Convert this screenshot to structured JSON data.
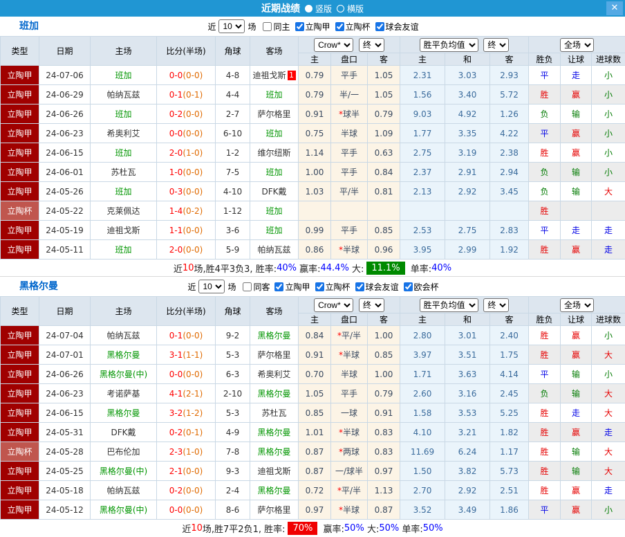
{
  "titlebar": {
    "title": "近期战绩",
    "vertical_label": "竖版",
    "horizontal_label": "横版",
    "close_glyph": "✕"
  },
  "colors": {
    "titlebar_blue": "#2096d3",
    "league_red": "#a00000",
    "cup_red": "#c0564e",
    "team_highlight_green": "#009500",
    "score_red": "#ff0000",
    "halftime_orange": "#e06a00",
    "win_red": "#e60000",
    "draw_blue": "#0000e6",
    "lose_green": "#007a00",
    "summary_badge_green": "#008a00",
    "summary_badge_red": "#f00000"
  },
  "sections": [
    {
      "team": "班加",
      "filter": {
        "near": "近",
        "count": "10",
        "games": "场",
        "same": {
          "label": "同主",
          "checked": false
        },
        "leagues": [
          {
            "label": "立陶甲",
            "checked": true
          },
          {
            "label": "立陶杯",
            "checked": true
          },
          {
            "label": "球会友谊",
            "checked": true
          }
        ]
      },
      "header": {
        "type": "类型",
        "date": "日期",
        "home": "主场",
        "score": "比分(半场)",
        "corner": "角球",
        "away": "客场",
        "company": "Crow*",
        "final1": "终",
        "avg_label": "胜平负均值",
        "final2": "终",
        "scope": "全场",
        "odds_cols": [
          "主",
          "盘口",
          "客"
        ],
        "avg_cols": [
          "主",
          "和",
          "客"
        ],
        "full_cols": [
          "胜负",
          "让球",
          "进球数"
        ]
      },
      "rows": [
        {
          "league": "立陶甲",
          "cup": false,
          "date": "24-07-06",
          "home": "班加",
          "hh": true,
          "score": "0-0",
          "half": "(0-0)",
          "corner": "4-8",
          "away": "迪祖戈斯",
          "ah": false,
          "badge": "1",
          "o1": "0.79",
          "star": false,
          "hcap": "平手",
          "o2": "1.05",
          "a1": "2.31",
          "a2": "3.03",
          "a3": "2.93",
          "res": [
            "平",
            "cb"
          ],
          "hres": [
            "走",
            "cb"
          ],
          "gres": [
            "小",
            "cg"
          ]
        },
        {
          "league": "立陶甲",
          "cup": false,
          "date": "24-06-29",
          "home": "帕纳瓦兹",
          "hh": false,
          "score": "0-1",
          "half": "(0-1)",
          "corner": "4-4",
          "away": "班加",
          "ah": true,
          "badge": "",
          "o1": "0.79",
          "star": false,
          "hcap": "半/一",
          "o2": "1.05",
          "a1": "1.56",
          "a2": "3.40",
          "a3": "5.72",
          "res": [
            "胜",
            "cr"
          ],
          "hres": [
            "赢",
            "cr"
          ],
          "gres": [
            "小",
            "cg"
          ]
        },
        {
          "league": "立陶甲",
          "cup": false,
          "date": "24-06-26",
          "home": "班加",
          "hh": true,
          "score": "0-2",
          "half": "(0-0)",
          "corner": "2-7",
          "away": "萨尔格里",
          "ah": false,
          "badge": "",
          "o1": "0.91",
          "star": true,
          "hcap": "球半",
          "o2": "0.79",
          "a1": "9.03",
          "a2": "4.92",
          "a3": "1.26",
          "res": [
            "负",
            "cg"
          ],
          "hres": [
            "输",
            "cg"
          ],
          "gres": [
            "小",
            "cg"
          ]
        },
        {
          "league": "立陶甲",
          "cup": false,
          "date": "24-06-23",
          "home": "希奥利艾",
          "hh": false,
          "score": "0-0",
          "half": "(0-0)",
          "corner": "6-10",
          "away": "班加",
          "ah": true,
          "badge": "",
          "o1": "0.75",
          "star": false,
          "hcap": "半球",
          "o2": "1.09",
          "a1": "1.77",
          "a2": "3.35",
          "a3": "4.22",
          "res": [
            "平",
            "cb"
          ],
          "hres": [
            "赢",
            "cr"
          ],
          "gres": [
            "小",
            "cg"
          ]
        },
        {
          "league": "立陶甲",
          "cup": false,
          "date": "24-06-15",
          "home": "班加",
          "hh": true,
          "score": "2-0",
          "half": "(1-0)",
          "corner": "1-2",
          "away": "维尔纽斯",
          "ah": false,
          "badge": "",
          "o1": "1.14",
          "star": false,
          "hcap": "平手",
          "o2": "0.63",
          "a1": "2.75",
          "a2": "3.19",
          "a3": "2.38",
          "res": [
            "胜",
            "cr"
          ],
          "hres": [
            "赢",
            "cr"
          ],
          "gres": [
            "小",
            "cg"
          ]
        },
        {
          "league": "立陶甲",
          "cup": false,
          "date": "24-06-01",
          "home": "苏杜瓦",
          "hh": false,
          "score": "1-0",
          "half": "(0-0)",
          "corner": "7-5",
          "away": "班加",
          "ah": true,
          "badge": "",
          "o1": "1.00",
          "star": false,
          "hcap": "平手",
          "o2": "0.84",
          "a1": "2.37",
          "a2": "2.91",
          "a3": "2.94",
          "res": [
            "负",
            "cg"
          ],
          "hres": [
            "输",
            "cg"
          ],
          "gres": [
            "小",
            "cg"
          ]
        },
        {
          "league": "立陶甲",
          "cup": false,
          "date": "24-05-26",
          "home": "班加",
          "hh": true,
          "score": "0-3",
          "half": "(0-0)",
          "corner": "4-10",
          "away": "DFK戴",
          "ah": false,
          "badge": "",
          "o1": "1.03",
          "star": false,
          "hcap": "平/半",
          "o2": "0.81",
          "a1": "2.13",
          "a2": "2.92",
          "a3": "3.45",
          "res": [
            "负",
            "cg"
          ],
          "hres": [
            "输",
            "cg"
          ],
          "gres": [
            "大",
            "cr"
          ]
        },
        {
          "league": "立陶杯",
          "cup": true,
          "date": "24-05-22",
          "home": "克莱佩达",
          "hh": false,
          "score": "1-4",
          "half": "(0-2)",
          "corner": "1-12",
          "away": "班加",
          "ah": true,
          "badge": "",
          "o1": "",
          "star": false,
          "hcap": "",
          "o2": "",
          "a1": "",
          "a2": "",
          "a3": "",
          "res": [
            "胜",
            "cr"
          ],
          "hres": [
            "",
            ""
          ],
          "gres": [
            "",
            ""
          ]
        },
        {
          "league": "立陶甲",
          "cup": false,
          "date": "24-05-19",
          "home": "迪祖戈斯",
          "hh": false,
          "score": "1-1",
          "half": "(0-0)",
          "corner": "3-6",
          "away": "班加",
          "ah": true,
          "badge": "",
          "o1": "0.99",
          "star": false,
          "hcap": "平手",
          "o2": "0.85",
          "a1": "2.53",
          "a2": "2.75",
          "a3": "2.83",
          "res": [
            "平",
            "cb"
          ],
          "hres": [
            "走",
            "cb"
          ],
          "gres": [
            "走",
            "cb"
          ]
        },
        {
          "league": "立陶甲",
          "cup": false,
          "date": "24-05-11",
          "home": "班加",
          "hh": true,
          "score": "2-0",
          "half": "(0-0)",
          "corner": "5-9",
          "away": "帕纳瓦兹",
          "ah": false,
          "badge": "",
          "o1": "0.86",
          "star": true,
          "hcap": "半球",
          "o2": "0.96",
          "a1": "3.95",
          "a2": "2.99",
          "a3": "1.92",
          "res": [
            "胜",
            "cr"
          ],
          "hres": [
            "赢",
            "cr"
          ],
          "gres": [
            "走",
            "cb"
          ]
        }
      ],
      "summary": [
        {
          "t": "近",
          "c": "k"
        },
        {
          "t": "10",
          "c": "r"
        },
        {
          "t": "场,胜4平3负3, 胜率:",
          "c": "k"
        },
        {
          "t": "40%",
          "c": "b"
        },
        {
          "t": " 赢率:",
          "c": "k"
        },
        {
          "t": "44.4%",
          "c": "b"
        },
        {
          "t": " 大:",
          "c": "k"
        },
        {
          "t": "11.1%",
          "c": "bg"
        },
        {
          "t": " 单率:",
          "c": "k"
        },
        {
          "t": "40%",
          "c": "b"
        }
      ]
    },
    {
      "team": "黑格尔曼",
      "filter": {
        "near": "近",
        "count": "10",
        "games": "场",
        "same": {
          "label": "同客",
          "checked": false
        },
        "leagues": [
          {
            "label": "立陶甲",
            "checked": true
          },
          {
            "label": "立陶杯",
            "checked": true
          },
          {
            "label": "球会友谊",
            "checked": true
          },
          {
            "label": "欧会杯",
            "checked": true
          }
        ]
      },
      "header": {
        "type": "类型",
        "date": "日期",
        "home": "主场",
        "score": "比分(半场)",
        "corner": "角球",
        "away": "客场",
        "company": "Crow*",
        "final1": "终",
        "avg_label": "胜平负均值",
        "final2": "终",
        "scope": "全场",
        "odds_cols": [
          "主",
          "盘口",
          "客"
        ],
        "avg_cols": [
          "主",
          "和",
          "客"
        ],
        "full_cols": [
          "胜负",
          "让球",
          "进球数"
        ]
      },
      "rows": [
        {
          "league": "立陶甲",
          "cup": false,
          "date": "24-07-04",
          "home": "帕纳瓦兹",
          "hh": false,
          "score": "0-1",
          "half": "(0-0)",
          "corner": "9-2",
          "away": "黑格尔曼",
          "ah": true,
          "badge": "",
          "o1": "0.84",
          "star": true,
          "hcap": "平/半",
          "o2": "1.00",
          "a1": "2.80",
          "a2": "3.01",
          "a3": "2.40",
          "res": [
            "胜",
            "cr"
          ],
          "hres": [
            "赢",
            "cr"
          ],
          "gres": [
            "小",
            "cg"
          ]
        },
        {
          "league": "立陶甲",
          "cup": false,
          "date": "24-07-01",
          "home": "黑格尔曼",
          "hh": true,
          "score": "3-1",
          "half": "(1-1)",
          "corner": "5-3",
          "away": "萨尔格里",
          "ah": false,
          "badge": "",
          "o1": "0.91",
          "star": true,
          "hcap": "半球",
          "o2": "0.85",
          "a1": "3.97",
          "a2": "3.51",
          "a3": "1.75",
          "res": [
            "胜",
            "cr"
          ],
          "hres": [
            "赢",
            "cr"
          ],
          "gres": [
            "大",
            "cr"
          ]
        },
        {
          "league": "立陶甲",
          "cup": false,
          "date": "24-06-26",
          "home": "黑格尔曼(中)",
          "hh": true,
          "score": "0-0",
          "half": "(0-0)",
          "corner": "6-3",
          "away": "希奥利艾",
          "ah": false,
          "badge": "",
          "o1": "0.70",
          "star": false,
          "hcap": "半球",
          "o2": "1.00",
          "a1": "1.71",
          "a2": "3.63",
          "a3": "4.14",
          "res": [
            "平",
            "cb"
          ],
          "hres": [
            "输",
            "cg"
          ],
          "gres": [
            "小",
            "cg"
          ]
        },
        {
          "league": "立陶甲",
          "cup": false,
          "date": "24-06-23",
          "home": "考诺萨基",
          "hh": false,
          "score": "4-1",
          "half": "(2-1)",
          "corner": "2-10",
          "away": "黑格尔曼",
          "ah": true,
          "badge": "",
          "o1": "1.05",
          "star": false,
          "hcap": "平手",
          "o2": "0.79",
          "a1": "2.60",
          "a2": "3.16",
          "a3": "2.45",
          "res": [
            "负",
            "cg"
          ],
          "hres": [
            "输",
            "cg"
          ],
          "gres": [
            "大",
            "cr"
          ]
        },
        {
          "league": "立陶甲",
          "cup": false,
          "date": "24-06-15",
          "home": "黑格尔曼",
          "hh": true,
          "score": "3-2",
          "half": "(1-2)",
          "corner": "5-3",
          "away": "苏杜瓦",
          "ah": false,
          "badge": "",
          "o1": "0.85",
          "star": false,
          "hcap": "一球",
          "o2": "0.91",
          "a1": "1.58",
          "a2": "3.53",
          "a3": "5.25",
          "res": [
            "胜",
            "cr"
          ],
          "hres": [
            "走",
            "cb"
          ],
          "gres": [
            "大",
            "cr"
          ]
        },
        {
          "league": "立陶甲",
          "cup": false,
          "date": "24-05-31",
          "home": "DFK戴",
          "hh": false,
          "score": "0-2",
          "half": "(0-1)",
          "corner": "4-9",
          "away": "黑格尔曼",
          "ah": true,
          "badge": "",
          "o1": "1.01",
          "star": true,
          "hcap": "半球",
          "o2": "0.83",
          "a1": "4.10",
          "a2": "3.21",
          "a3": "1.82",
          "res": [
            "胜",
            "cr"
          ],
          "hres": [
            "赢",
            "cr"
          ],
          "gres": [
            "走",
            "cb"
          ]
        },
        {
          "league": "立陶杯",
          "cup": true,
          "date": "24-05-28",
          "home": "巴布伦加",
          "hh": false,
          "score": "2-3",
          "half": "(1-0)",
          "corner": "7-8",
          "away": "黑格尔曼",
          "ah": true,
          "badge": "",
          "o1": "0.87",
          "star": true,
          "hcap": "两球",
          "o2": "0.83",
          "a1": "11.69",
          "a2": "6.24",
          "a3": "1.17",
          "res": [
            "胜",
            "cr"
          ],
          "hres": [
            "输",
            "cg"
          ],
          "gres": [
            "大",
            "cr"
          ]
        },
        {
          "league": "立陶甲",
          "cup": false,
          "date": "24-05-25",
          "home": "黑格尔曼(中)",
          "hh": true,
          "score": "2-1",
          "half": "(0-0)",
          "corner": "9-3",
          "away": "迪祖戈斯",
          "ah": false,
          "badge": "",
          "o1": "0.87",
          "star": false,
          "hcap": "一/球半",
          "o2": "0.97",
          "a1": "1.50",
          "a2": "3.82",
          "a3": "5.73",
          "res": [
            "胜",
            "cr"
          ],
          "hres": [
            "输",
            "cg"
          ],
          "gres": [
            "大",
            "cr"
          ]
        },
        {
          "league": "立陶甲",
          "cup": false,
          "date": "24-05-18",
          "home": "帕纳瓦兹",
          "hh": false,
          "score": "0-2",
          "half": "(0-0)",
          "corner": "2-4",
          "away": "黑格尔曼",
          "ah": true,
          "badge": "",
          "o1": "0.72",
          "star": true,
          "hcap": "平/半",
          "o2": "1.13",
          "a1": "2.70",
          "a2": "2.92",
          "a3": "2.51",
          "res": [
            "胜",
            "cr"
          ],
          "hres": [
            "赢",
            "cr"
          ],
          "gres": [
            "走",
            "cb"
          ]
        },
        {
          "league": "立陶甲",
          "cup": false,
          "date": "24-05-12",
          "home": "黑格尔曼(中)",
          "hh": true,
          "score": "0-0",
          "half": "(0-0)",
          "corner": "8-6",
          "away": "萨尔格里",
          "ah": false,
          "badge": "",
          "o1": "0.97",
          "star": true,
          "hcap": "半球",
          "o2": "0.87",
          "a1": "3.52",
          "a2": "3.49",
          "a3": "1.86",
          "res": [
            "平",
            "cb"
          ],
          "hres": [
            "赢",
            "cr"
          ],
          "gres": [
            "小",
            "cg"
          ]
        }
      ],
      "summary": [
        {
          "t": "近",
          "c": "k"
        },
        {
          "t": "10",
          "c": "r"
        },
        {
          "t": "场,胜7平2负1, 胜率:",
          "c": "k"
        },
        {
          "t": "70%",
          "c": "br"
        },
        {
          "t": " 赢率:",
          "c": "k"
        },
        {
          "t": "50%",
          "c": "b"
        },
        {
          "t": " 大:",
          "c": "k"
        },
        {
          "t": "50%",
          "c": "b"
        },
        {
          "t": " 单率:",
          "c": "k"
        },
        {
          "t": "50%",
          "c": "b"
        }
      ]
    }
  ]
}
